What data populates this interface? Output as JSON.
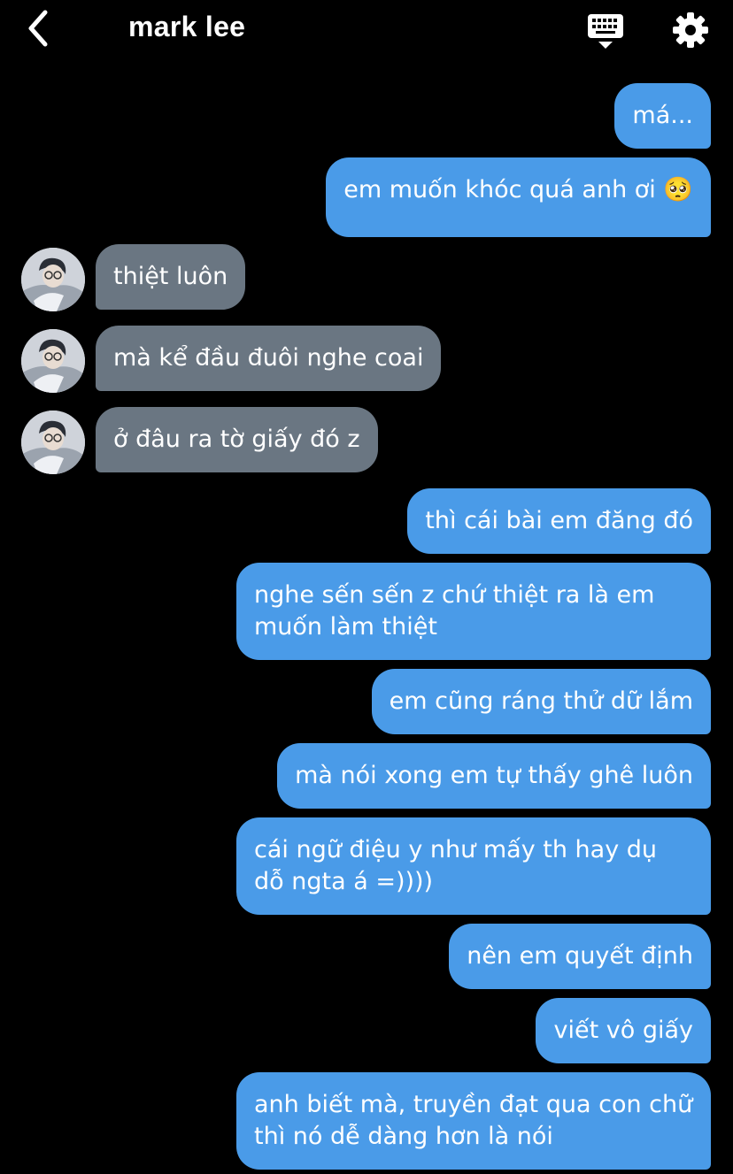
{
  "header": {
    "title": "mark lee",
    "back_icon": "chevron-left-icon",
    "keyboard_icon": "keyboard-icon",
    "settings_icon": "gear-icon"
  },
  "colors": {
    "background": "#000000",
    "outgoing_bubble": "#4a9be8",
    "incoming_bubble": "#6a7682",
    "text": "#ffffff"
  },
  "messages": [
    {
      "from": "me",
      "text": "má..."
    },
    {
      "from": "me",
      "text": "em muốn khóc quá anh ơi 🥺"
    },
    {
      "from": "them",
      "text": "thiệt luôn"
    },
    {
      "from": "them",
      "text": "mà kể đầu đuôi nghe coai"
    },
    {
      "from": "them",
      "text": "ở đâu ra tờ giấy đó z"
    },
    {
      "from": "me",
      "text": "thì cái bài em đăng đó"
    },
    {
      "from": "me",
      "text": "nghe sến sến z chứ thiệt ra là em muốn làm thiệt"
    },
    {
      "from": "me",
      "text": "em cũng ráng thử dữ lắm"
    },
    {
      "from": "me",
      "text": "mà nói xong em tự thấy ghê luôn"
    },
    {
      "from": "me",
      "text": "cái ngữ điệu y như mấy th hay dụ dỗ ngta á =))))"
    },
    {
      "from": "me",
      "text": "nên em quyết định"
    },
    {
      "from": "me",
      "text": "viết vô giấy"
    },
    {
      "from": "me",
      "text": "anh biết mà, truyền đạt qua con chữ thì nó dễ dàng hơn là nói"
    }
  ]
}
